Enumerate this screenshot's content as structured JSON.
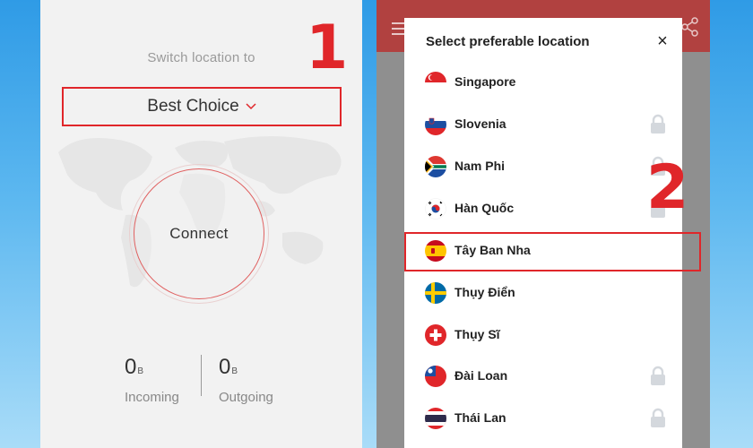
{
  "left_screen": {
    "switch_label": "Switch location to",
    "location_select": {
      "value": "Best Choice",
      "icon": "chevron-down-icon"
    },
    "step_marker": "1",
    "connect_label": "Connect",
    "incoming": {
      "value": "0",
      "unit": "B",
      "label": "Incoming"
    },
    "outgoing": {
      "value": "0",
      "unit": "B",
      "label": "Outgoing"
    }
  },
  "right_screen": {
    "app_bar_color": "#b14140",
    "dialog": {
      "title": "Select preferable location",
      "close_label": "×"
    },
    "step_marker": "2",
    "highlighted_item": "Tây Ban Nha",
    "locations": [
      {
        "name": "Singapore",
        "flag": "singapore-flag-icon",
        "locked": false
      },
      {
        "name": "Slovenia",
        "flag": "slovenia-flag-icon",
        "locked": true
      },
      {
        "name": "Nam Phi",
        "flag": "south-africa-flag-icon",
        "locked": true
      },
      {
        "name": "Hàn Quốc",
        "flag": "south-korea-flag-icon",
        "locked": true
      },
      {
        "name": "Tây Ban Nha",
        "flag": "spain-flag-icon",
        "locked": false
      },
      {
        "name": "Thụy Điển",
        "flag": "sweden-flag-icon",
        "locked": false
      },
      {
        "name": "Thụy Sĩ",
        "flag": "switzerland-flag-icon",
        "locked": false
      },
      {
        "name": "Đài Loan",
        "flag": "taiwan-flag-icon",
        "locked": true
      },
      {
        "name": "Thái Lan",
        "flag": "thailand-flag-icon",
        "locked": true
      }
    ]
  },
  "colors": {
    "accent_red": "#e0262a",
    "background_blue": "#2f9be6",
    "lock_gray": "#d4d8dd"
  }
}
